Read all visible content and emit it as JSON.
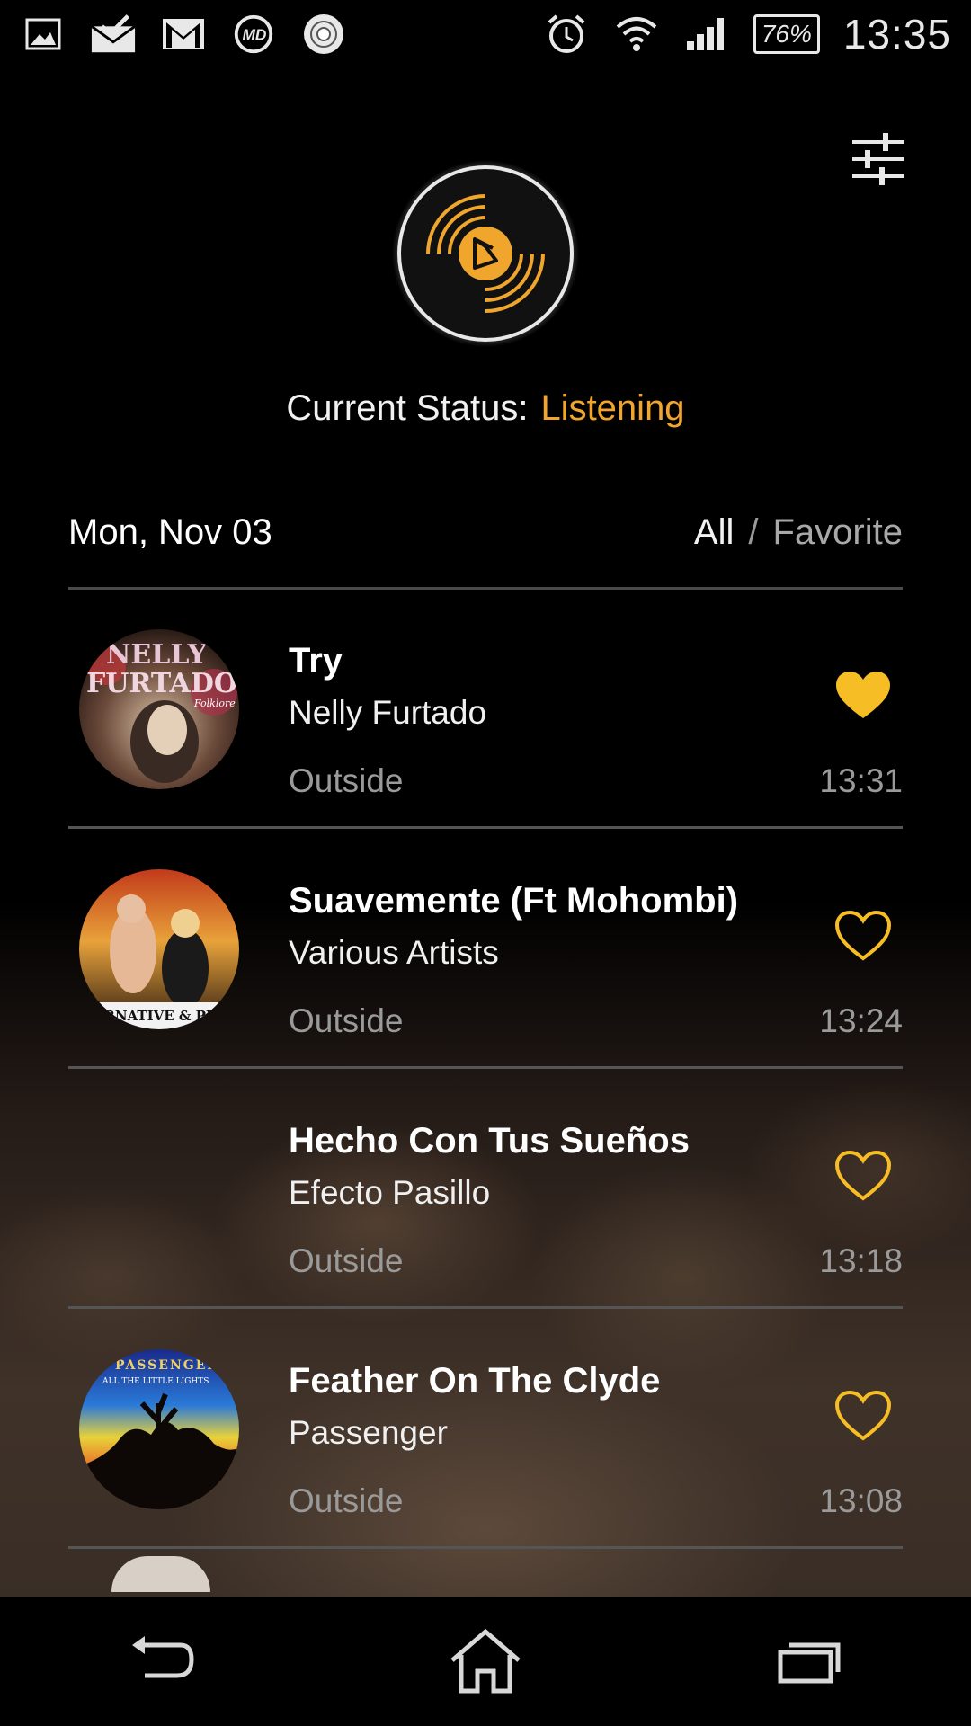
{
  "status_bar": {
    "battery": "76%",
    "time": "13:35",
    "left_icons": [
      "picture-icon",
      "mail-done-icon",
      "gmail-icon",
      "md-app-icon",
      "vinyl-app-icon"
    ],
    "right_icons": [
      "alarm-icon",
      "wifi-icon",
      "signal-icon"
    ]
  },
  "header": {
    "status_label": "Current Status:",
    "status_value": "Listening",
    "date": "Mon, Nov 03",
    "filter_all": "All",
    "filter_sep": "/",
    "filter_favorite": "Favorite"
  },
  "colors": {
    "accent": "#f0a52c",
    "heart": "#f6bd25",
    "divider": "#4a4a4a"
  },
  "songs": [
    {
      "title": "Try",
      "artist": "Nelly Furtado",
      "place": "Outside",
      "time": "13:31",
      "favorite": true
    },
    {
      "title": "Suavemente (Ft Mohombi)",
      "artist": "Various Artists",
      "place": "Outside",
      "time": "13:24",
      "favorite": false
    },
    {
      "title": "Hecho Con Tus Sueños",
      "artist": "Efecto Pasillo",
      "place": "Outside",
      "time": "13:18",
      "favorite": false
    },
    {
      "title": "Feather On The Clyde",
      "artist": "Passenger",
      "place": "Outside",
      "time": "13:08",
      "favorite": false
    }
  ],
  "album_art_text": {
    "art0_line1": "NELLY",
    "art0_line2": "FURTADO",
    "art0_line3": "Folklore",
    "art1_line1": "ERNATIVE & PU",
    "art3_line1": "PASSENGER",
    "art3_line2": "ALL THE LITTLE LIGHTS"
  },
  "nav": [
    "back-icon",
    "home-icon",
    "recent-apps-icon"
  ]
}
